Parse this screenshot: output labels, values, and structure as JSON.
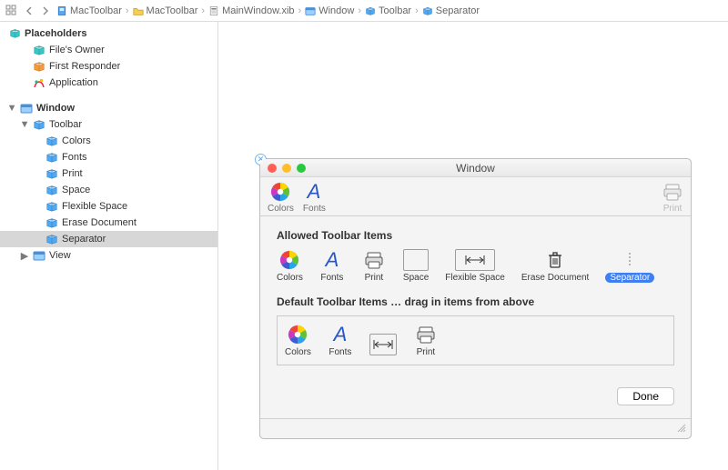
{
  "breadcrumb": [
    {
      "icon": "proj-blue",
      "label": "MacToolbar"
    },
    {
      "icon": "folder",
      "label": "MacToolbar"
    },
    {
      "icon": "xib",
      "label": "MainWindow.xib"
    },
    {
      "icon": "win",
      "label": "Window"
    },
    {
      "icon": "cube",
      "label": "Toolbar"
    },
    {
      "icon": "cube",
      "label": "Separator"
    }
  ],
  "sidebar": {
    "placeholders_header": "Placeholders",
    "placeholders": [
      {
        "label": "File's Owner",
        "icon": "cube-teal"
      },
      {
        "label": "First Responder",
        "icon": "cube-org"
      },
      {
        "label": "Application",
        "icon": "app"
      }
    ],
    "window_label": "Window",
    "toolbar_label": "Toolbar",
    "toolbar_items": [
      {
        "label": "Colors"
      },
      {
        "label": "Fonts"
      },
      {
        "label": "Print"
      },
      {
        "label": "Space"
      },
      {
        "label": "Flexible Space"
      },
      {
        "label": "Erase Document"
      },
      {
        "label": "Separator"
      }
    ],
    "view_label": "View"
  },
  "preview": {
    "window_title": "Window",
    "toolbar_live": [
      {
        "label": "Colors",
        "icon": "colorwheel"
      },
      {
        "label": "Fonts",
        "icon": "font"
      }
    ],
    "toolbar_live_right": {
      "label": "Print",
      "icon": "printer"
    },
    "allowed_title": "Allowed Toolbar Items",
    "allowed": [
      {
        "label": "Colors",
        "icon": "colorwheel"
      },
      {
        "label": "Fonts",
        "icon": "font"
      },
      {
        "label": "Print",
        "icon": "printer"
      },
      {
        "label": "Space",
        "icon": "space"
      },
      {
        "label": "Flexible Space",
        "icon": "flex"
      },
      {
        "label": "Erase Document",
        "icon": "trash"
      },
      {
        "label": "Separator",
        "icon": "sep",
        "selected": true
      }
    ],
    "default_title": "Default Toolbar Items … drag in items from above",
    "defaults": [
      {
        "label": "Colors",
        "icon": "colorwheel"
      },
      {
        "label": "Fonts",
        "icon": "font"
      },
      {
        "label": "",
        "icon": "flex"
      },
      {
        "label": "Print",
        "icon": "printer"
      }
    ],
    "done_label": "Done"
  }
}
